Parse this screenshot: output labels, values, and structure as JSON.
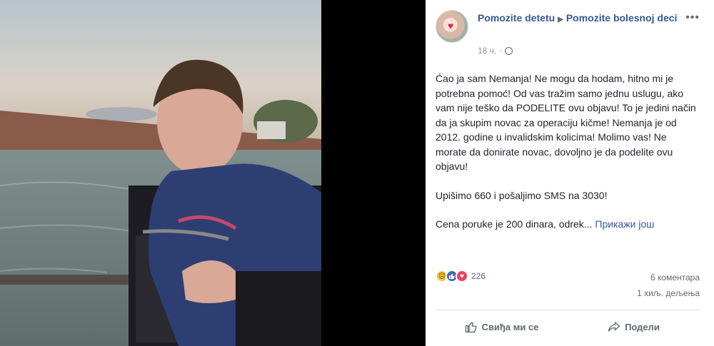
{
  "post": {
    "page_name": "Pomozite detetu",
    "target_name": "Pomozite bolesnoj deci",
    "time": "18 ч.",
    "paragraphs": [
      "Ćao ja sam Nemanja! Ne mogu da hodam, hitno mi je potrebna pomoć! Od vas tražim samo jednu uslugu, ako vam nije teško da PODELITE ovu objavu! To je jedini način da ja skupim novac za operaciju kičme! Nemanja je od 2012. godine u invalidskim kolicima! Molimo vas! Ne morate da donirate novac, dovoljno je da podelite ovu objavu!",
      "Upišimo 660 i pošaljimo SMS na 3030!"
    ],
    "truncated_text": "Cena poruke je 200 dinara, odrek...",
    "see_more_label": "Прикажи још"
  },
  "stats": {
    "reaction_count": "226",
    "comments": "6 коментара",
    "shares": "1 хиљ. дељења"
  },
  "actions": {
    "like_label": "Свиђа ми се",
    "share_label": "Подели"
  },
  "icons": {
    "more": "more-options-icon",
    "globe": "globe-icon",
    "like": "thumbs-up-icon",
    "share": "share-arrow-icon"
  },
  "colors": {
    "link": "#385898",
    "text": "#1d2129",
    "muted": "#606770",
    "like_blue": "#4267b2",
    "love_red": "#f33e58",
    "sad_yellow": "#f5c33b"
  }
}
